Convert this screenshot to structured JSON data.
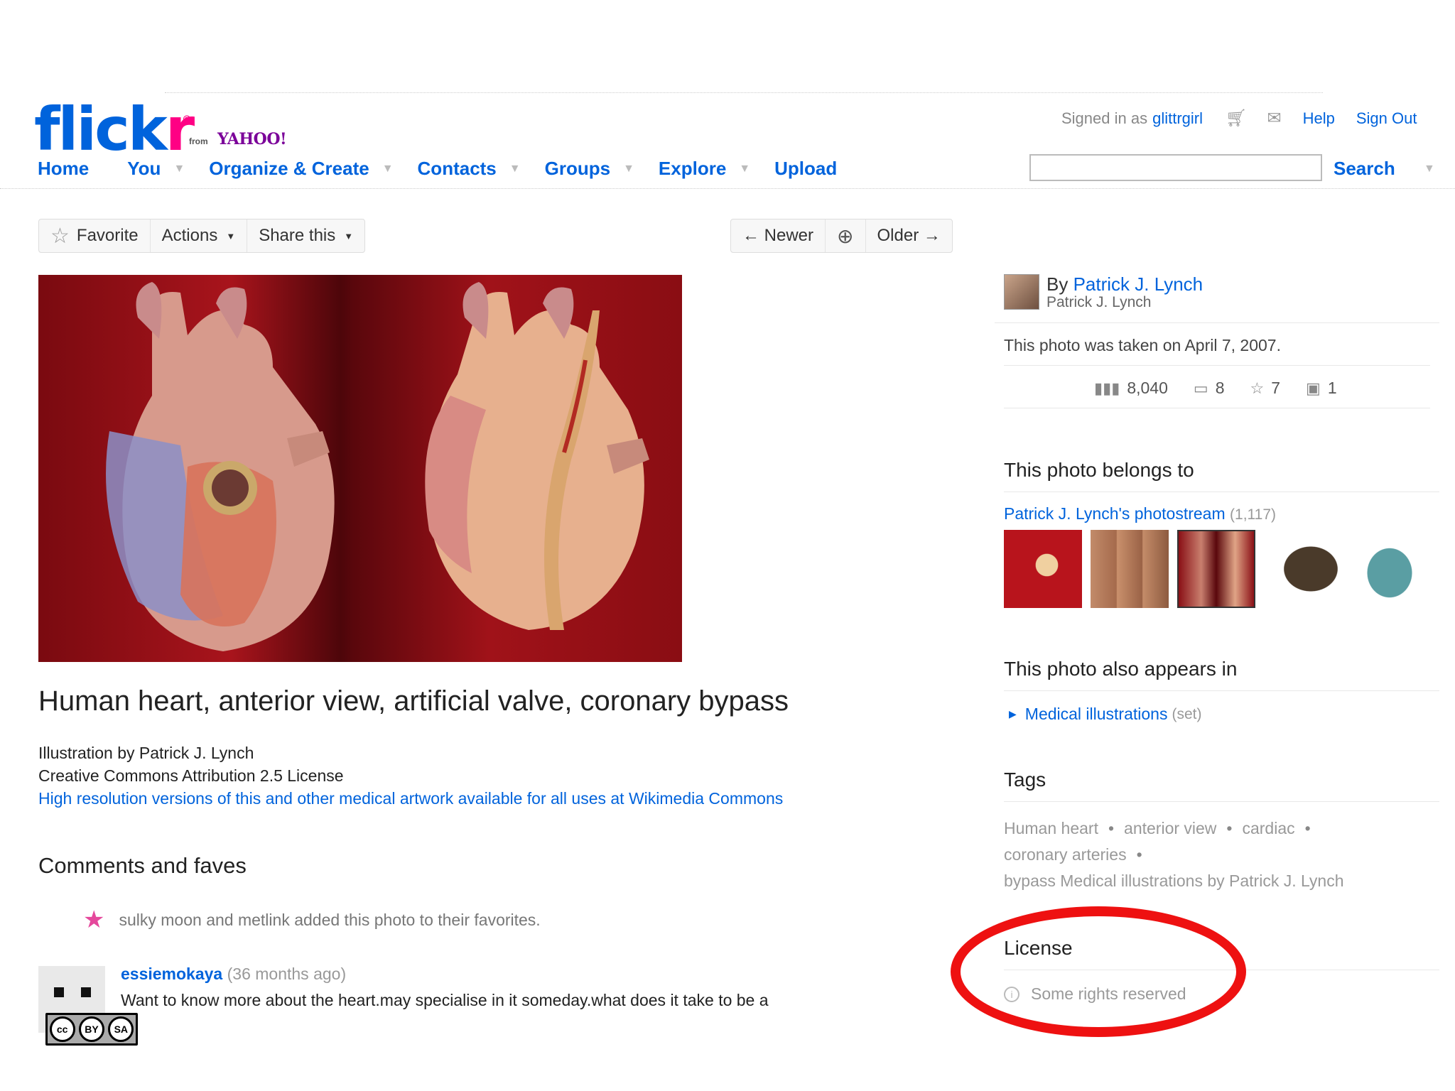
{
  "brand": {
    "logo_main": "flick",
    "logo_r": "r",
    "logo_reg": "®",
    "from": "from",
    "yahoo": "YAHOO!"
  },
  "nav": {
    "items": [
      {
        "label": "Home",
        "dropdown": false
      },
      {
        "label": "You",
        "dropdown": true
      },
      {
        "label": "Organize & Create",
        "dropdown": true
      },
      {
        "label": "Contacts",
        "dropdown": true
      },
      {
        "label": "Groups",
        "dropdown": true
      },
      {
        "label": "Explore",
        "dropdown": true
      },
      {
        "label": "Upload",
        "dropdown": false
      }
    ]
  },
  "account": {
    "signed_in_prefix": "Signed in as",
    "username": "glittrgirl",
    "cart_icon": "cart-icon",
    "mail_icon": "mail-icon",
    "help": "Help",
    "sign_out": "Sign Out"
  },
  "search": {
    "placeholder": "",
    "button": "Search"
  },
  "actions": {
    "favorite": "Favorite",
    "actions": "Actions",
    "share": "Share this",
    "newer": "← Newer",
    "older": "Older →"
  },
  "photo": {
    "title": "Human heart, anterior view, artificial valve, coronary bypass",
    "desc_line1": "Illustration by Patrick J. Lynch",
    "desc_line2": "Creative Commons Attribution 2.5 License",
    "desc_link": "High resolution versions of this and other medical artwork available for all uses at Wikimedia Commons"
  },
  "comments": {
    "heading": "Comments and faves",
    "fav_text": "sulky moon and metlink added this photo to their favorites.",
    "items": [
      {
        "author": "essiemokaya",
        "ago": "(36 months ago)",
        "text": "Want to know more about the heart.may specialise in it someday.what does it take to be a"
      }
    ]
  },
  "cc_badge": {
    "cc": "cc",
    "by": "BY",
    "sa": "SA"
  },
  "sidebar": {
    "by_prefix": "By",
    "author": "Patrick J. Lynch",
    "author_sub": "Patrick J. Lynch",
    "taken": "This photo was taken on April 7, 2007.",
    "stats": {
      "views": "8,040",
      "comments": "8",
      "faves": "7",
      "sets": "1"
    },
    "belongs_heading": "This photo belongs to",
    "photostream": "Patrick J. Lynch's photostream",
    "photostream_count": "(1,117)",
    "appears_heading": "This photo also appears in",
    "set_name": "Medical illustrations",
    "set_kind": "(set)",
    "tags_heading": "Tags",
    "tags_line1": [
      "Human heart",
      "anterior view",
      "cardiac"
    ],
    "tags_line2": [
      "coronary arteries"
    ],
    "tags_line3": "bypass Medical illustrations by Patrick J. Lynch",
    "license_heading": "License",
    "license_text": "Some rights reserved"
  },
  "colors": {
    "link": "#0063dc",
    "flickr_pink": "#ff0084",
    "annotation": "#ee1111"
  }
}
